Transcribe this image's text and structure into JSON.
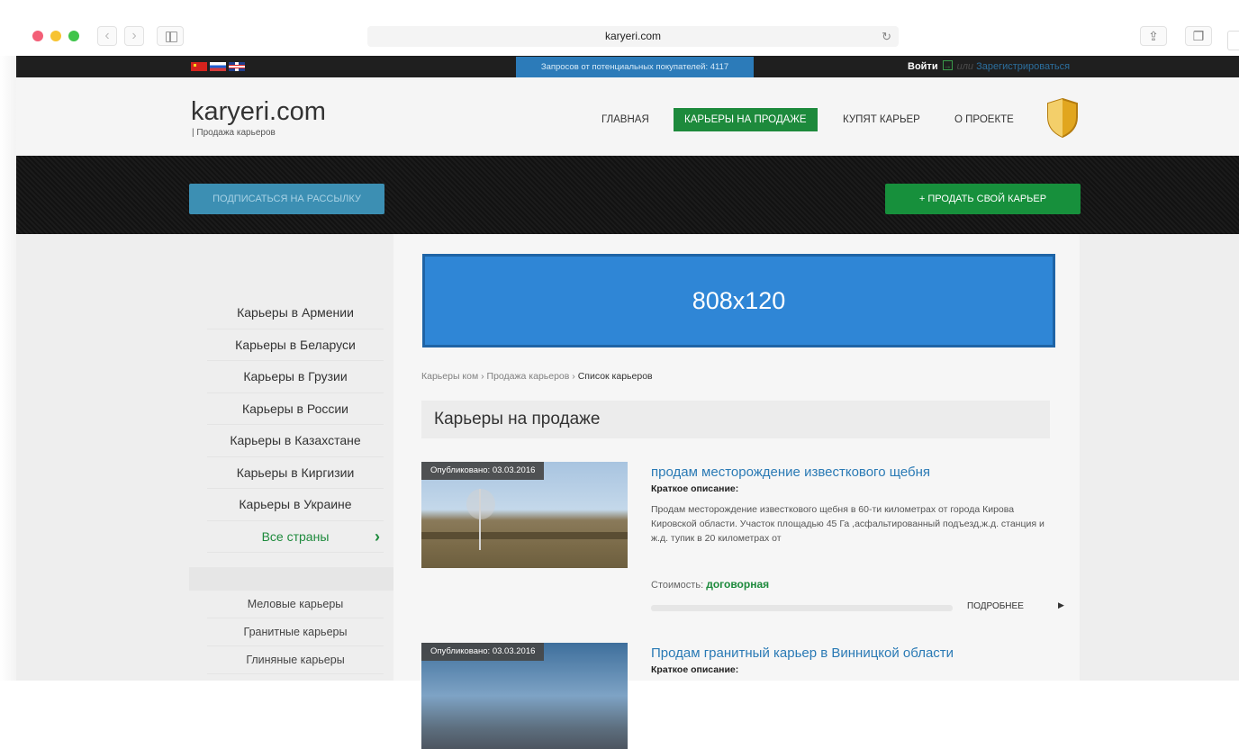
{
  "browser": {
    "url": "karyeri.com"
  },
  "topbar": {
    "requests_text": "Запросов от потенциальных покупателей: 4117",
    "login": "Войти",
    "or": "или",
    "register": "Зарегистрироваться"
  },
  "header": {
    "logo": "karyeri.com",
    "tagline": "| Продажа карьеров",
    "nav": [
      "ГЛАВНАЯ",
      "КАРЬЕРЫ НА ПРОДАЖЕ",
      "КУПЯТ КАРЬЕР",
      "О ПРОЕКТЕ"
    ]
  },
  "band": {
    "subscribe": "ПОДПИСАТЬСЯ НА РАССЫЛКУ",
    "sell": "+ ПРОДАТЬ СВОЙ КАРЬЕР"
  },
  "sidebar": {
    "countries": [
      "Карьеры в Армении",
      "Карьеры в Беларуси",
      "Карьеры в Грузии",
      "Карьеры в России",
      "Карьеры в Казахстане",
      "Карьеры в Киргизии",
      "Карьеры в Украине"
    ],
    "all_countries": "Все страны",
    "types": [
      "Меловые карьеры",
      "Гранитные карьеры",
      "Глиняные карьеры"
    ]
  },
  "main": {
    "banner": "808x120",
    "breadcrumb": {
      "home": "Карьеры ком",
      "sep": "›",
      "section": "Продажа карьеров",
      "current": "Список карьеров"
    },
    "page_title": "Карьеры на продаже",
    "listings": [
      {
        "published": "Опубликовано: 03.03.2016",
        "title": "продам месторождение известкового щебня",
        "desc_label": "Краткое описание:",
        "desc": "Продам месторождение известкового щебня в 60-ти километрах от города Кирова Кировской области. Участок площадью 45 Га ,асфальтированный подъезд,ж.д. станция и ж.д. тупик в 20 километрах от",
        "price_label": "Стоимость:",
        "price": "договорная",
        "more": "ПОДРОБНЕЕ"
      },
      {
        "published": "Опубликовано: 03.03.2016",
        "title": "Продам гранитный карьер в Винницкой области",
        "desc_label": "Краткое описание:"
      }
    ]
  },
  "colors": {
    "accent_green": "#1d8a3c",
    "banner_blue": "#2f86d6",
    "link_blue": "#2a7ab5",
    "topbar_dark": "#1f1f1f"
  }
}
